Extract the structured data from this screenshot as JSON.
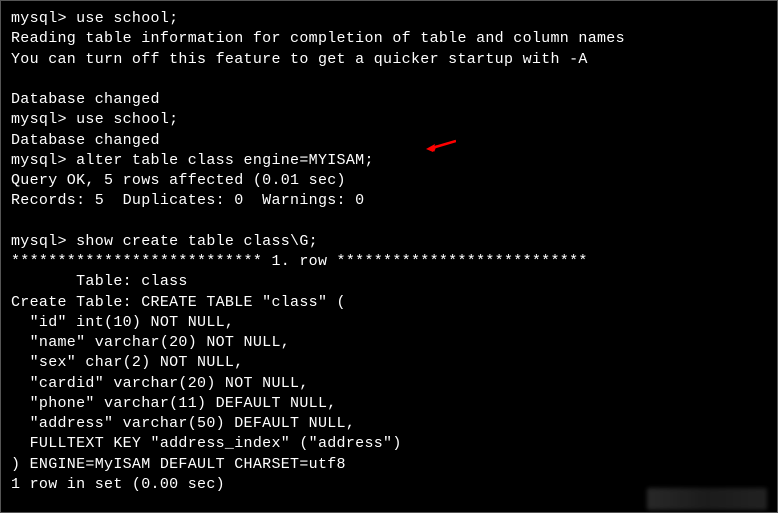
{
  "terminal": {
    "lines": [
      "mysql> use school;",
      "Reading table information for completion of table and column names",
      "You can turn off this feature to get a quicker startup with -A",
      "",
      "Database changed",
      "mysql> use school;",
      "Database changed",
      "mysql> alter table class engine=MYISAM;",
      "Query OK, 5 rows affected (0.01 sec)",
      "Records: 5  Duplicates: 0  Warnings: 0",
      "",
      "mysql> show create table class\\G;",
      "*************************** 1. row ***************************",
      "       Table: class",
      "Create Table: CREATE TABLE \"class\" (",
      "  \"id\" int(10) NOT NULL,",
      "  \"name\" varchar(20) NOT NULL,",
      "  \"sex\" char(2) NOT NULL,",
      "  \"cardid\" varchar(20) NOT NULL,",
      "  \"phone\" varchar(11) DEFAULT NULL,",
      "  \"address\" varchar(50) DEFAULT NULL,",
      "  FULLTEXT KEY \"address_index\" (\"address\")",
      ") ENGINE=MyISAM DEFAULT CHARSET=utf8",
      "1 row in set (0.00 sec)"
    ]
  },
  "annotation": {
    "arrow_color": "#ff0000"
  }
}
